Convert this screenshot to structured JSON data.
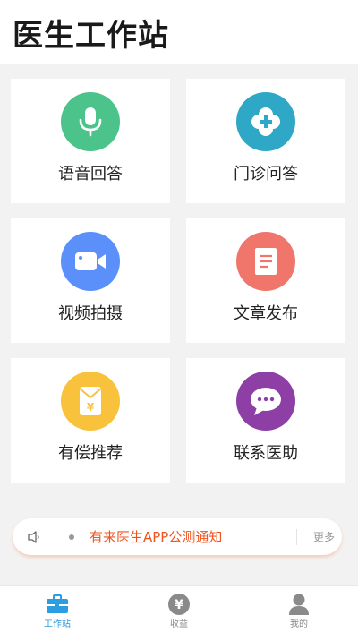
{
  "header": {
    "title": "医生工作站"
  },
  "tiles": [
    {
      "label": "语音回答",
      "icon": "microphone-icon",
      "color": "#4cc38a"
    },
    {
      "label": "门诊问答",
      "icon": "clinic-cross-icon",
      "color": "#2ea8c6"
    },
    {
      "label": "视频拍摄",
      "icon": "video-camera-icon",
      "color": "#5b8ff9"
    },
    {
      "label": "文章发布",
      "icon": "document-icon",
      "color": "#f0766c"
    },
    {
      "label": "有偿推荐",
      "icon": "yuan-envelope-icon",
      "color": "#f8c23c"
    },
    {
      "label": "联系医助",
      "icon": "chat-bubble-icon",
      "color": "#8e3fa6"
    }
  ],
  "notice": {
    "icon": "speaker-icon",
    "text": "有来医生APP公测通知",
    "more_label": "更多",
    "text_color": "#f0541e"
  },
  "tabbar": {
    "items": [
      {
        "label": "工作站",
        "icon": "briefcase-icon",
        "active": true
      },
      {
        "label": "收益",
        "icon": "yuan-coin-icon",
        "active": false
      },
      {
        "label": "我的",
        "icon": "person-icon",
        "active": false
      }
    ],
    "active_color": "#2c9de0",
    "inactive_color": "#888888"
  }
}
